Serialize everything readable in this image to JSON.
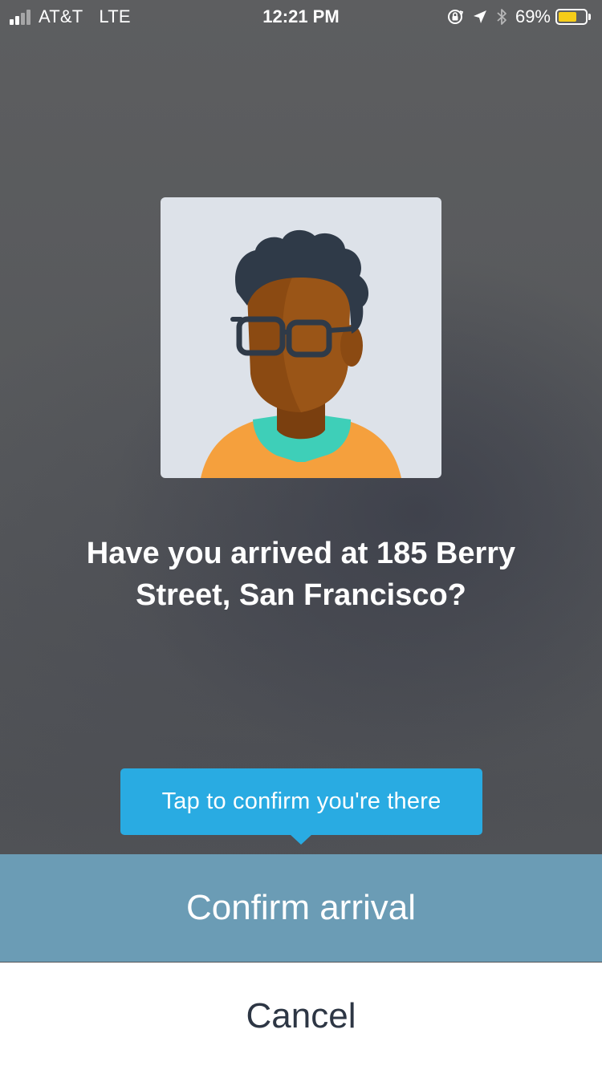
{
  "status_bar": {
    "carrier": "AT&T",
    "network": "LTE",
    "time": "12:21 PM",
    "battery_percent": "69%",
    "battery_level": 0.69,
    "icons": [
      "signal-icon",
      "orientation-lock-icon",
      "location-arrow-icon",
      "bluetooth-icon",
      "battery-icon"
    ]
  },
  "avatar": {
    "icon": "person-avatar-illustration",
    "colors": {
      "background": "#dde2e9",
      "skin": "#8b4a12",
      "skin_shadow": "#6e3a0d",
      "hair": "#2f3a48",
      "glasses": "#2f3a48",
      "shirt": "#f5a03d",
      "collar": "#3ecfb8"
    }
  },
  "question": {
    "text": "Have you arrived at 185 Berry Street, San Francisco?"
  },
  "tooltip": {
    "text": "Tap to confirm you're there",
    "color": "#29abe2"
  },
  "actions": {
    "confirm_label": "Confirm arrival",
    "confirm_color": "#6b9cb5",
    "cancel_label": "Cancel"
  }
}
